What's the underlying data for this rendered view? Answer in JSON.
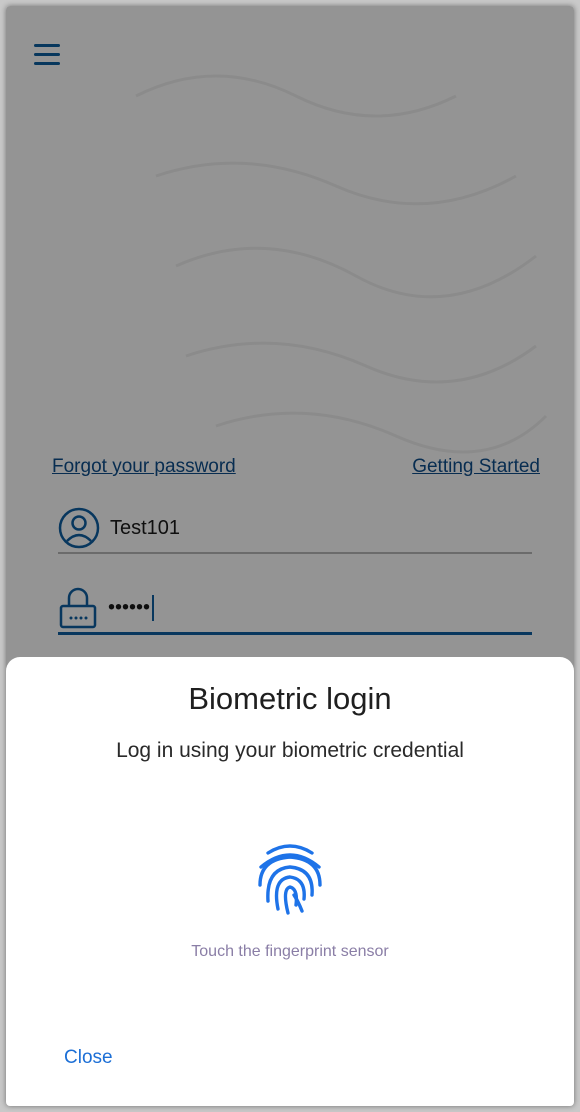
{
  "login": {
    "forgot_password_link": "Forgot your password",
    "getting_started_link": "Getting Started",
    "username_value": "Test101",
    "password_masked": "••••••"
  },
  "biometric_dialog": {
    "title": "Biometric login",
    "subtitle": "Log in using your biometric credential",
    "hint": "Touch the fingerprint sensor",
    "close_label": "Close"
  },
  "icons": {
    "menu": "hamburger-menu-icon",
    "user": "user-circle-icon",
    "password": "lock-icon",
    "fingerprint": "fingerprint-icon"
  },
  "colors": {
    "primary": "#0f5fa3",
    "link": "#0f4f8c",
    "fingerprint": "#1e73e8",
    "close": "#1c6fd6",
    "hint": "#8a7ea6"
  }
}
